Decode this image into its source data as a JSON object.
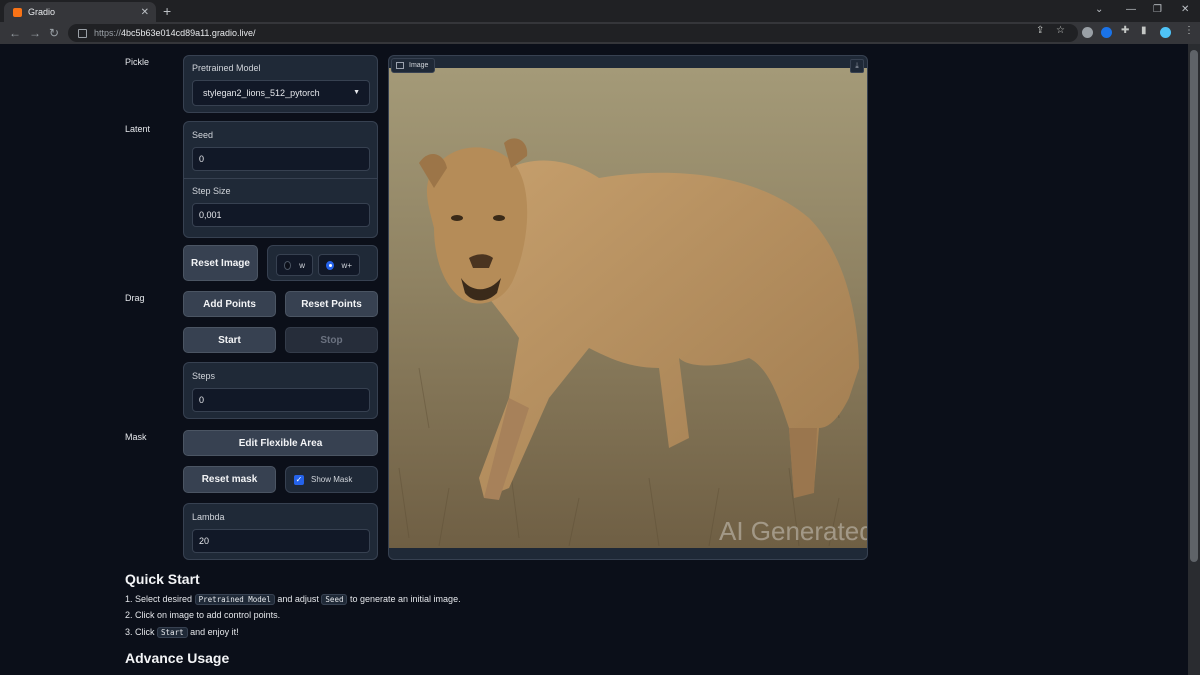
{
  "browser": {
    "tab_title": "Gradio",
    "url_protocol": "https://",
    "url_host": "4bc5b63e014cd89a11.gradio.live/",
    "new_tab": "+",
    "tab_close": "✕"
  },
  "sections": {
    "pickle": "Pickle",
    "latent": "Latent",
    "drag": "Drag",
    "mask": "Mask"
  },
  "pretrained": {
    "label": "Pretrained Model",
    "value": "stylegan2_lions_512_pytorch"
  },
  "seed": {
    "label": "Seed",
    "value": "0"
  },
  "step_size": {
    "label": "Step Size",
    "value": "0,001"
  },
  "buttons": {
    "reset_image": "Reset Image",
    "add_points": "Add Points",
    "reset_points": "Reset Points",
    "start": "Start",
    "stop": "Stop",
    "edit_flexible_area": "Edit Flexible Area",
    "reset_mask": "Reset mask"
  },
  "latent_space": {
    "options": [
      "w",
      "w+"
    ],
    "selected": "w+"
  },
  "steps": {
    "label": "Steps",
    "value": "0"
  },
  "show_mask": {
    "label": "Show Mask",
    "checked": true
  },
  "lambda": {
    "label": "Lambda",
    "value": "20"
  },
  "image": {
    "label": "Image",
    "watermark": "AI Generated"
  },
  "quick_start": {
    "title": "Quick Start",
    "step1": {
      "n": "1.",
      "a": "Select desired",
      "code1": "Pretrained Model",
      "b": "and adjust",
      "code2": "Seed",
      "c": "to generate an initial image."
    },
    "step2": "2. Click on image to add control points.",
    "step3": {
      "a": "3. Click",
      "code": "Start",
      "b": "and enjoy it!"
    }
  },
  "advance_usage": {
    "title": "Advance Usage"
  },
  "colors": {
    "background": "#0b0f19",
    "panel": "#1f2937",
    "accent": "#2563eb"
  }
}
